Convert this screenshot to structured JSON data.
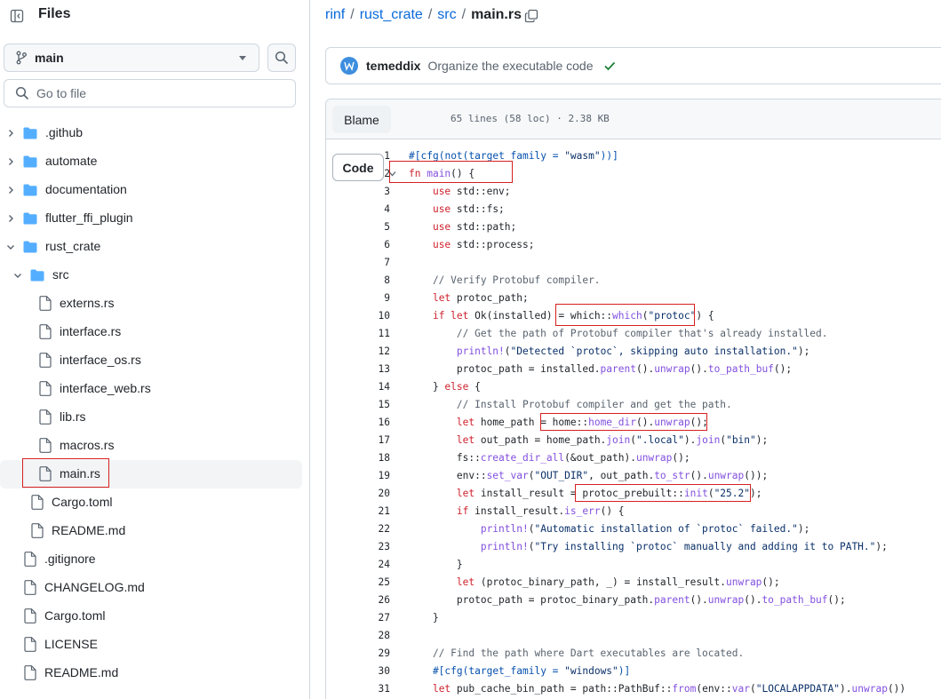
{
  "sidebar": {
    "title": "Files",
    "branch": "main",
    "goto_placeholder": "Go to file",
    "tree": [
      {
        "label": ".github",
        "kind": "folder",
        "depth": 0,
        "expanded": false
      },
      {
        "label": "automate",
        "kind": "folder",
        "depth": 0,
        "expanded": false
      },
      {
        "label": "documentation",
        "kind": "folder",
        "depth": 0,
        "expanded": false
      },
      {
        "label": "flutter_ffi_plugin",
        "kind": "folder",
        "depth": 0,
        "expanded": false
      },
      {
        "label": "rust_crate",
        "kind": "folder",
        "depth": 0,
        "expanded": true
      },
      {
        "label": "src",
        "kind": "folder",
        "depth": 1,
        "expanded": true
      },
      {
        "label": "externs.rs",
        "kind": "file",
        "depth": 2
      },
      {
        "label": "interface.rs",
        "kind": "file",
        "depth": 2
      },
      {
        "label": "interface_os.rs",
        "kind": "file",
        "depth": 2
      },
      {
        "label": "interface_web.rs",
        "kind": "file",
        "depth": 2
      },
      {
        "label": "lib.rs",
        "kind": "file",
        "depth": 2
      },
      {
        "label": "macros.rs",
        "kind": "file",
        "depth": 2
      },
      {
        "label": "main.rs",
        "kind": "file",
        "depth": 2,
        "selected": true
      },
      {
        "label": "Cargo.toml",
        "kind": "file",
        "depth": 1
      },
      {
        "label": "README.md",
        "kind": "file",
        "depth": 1
      },
      {
        "label": ".gitignore",
        "kind": "file",
        "depth": 0
      },
      {
        "label": "CHANGELOG.md",
        "kind": "file",
        "depth": 0
      },
      {
        "label": "Cargo.toml",
        "kind": "file",
        "depth": 0
      },
      {
        "label": "LICENSE",
        "kind": "file",
        "depth": 0
      },
      {
        "label": "README.md",
        "kind": "file",
        "depth": 0
      }
    ]
  },
  "breadcrumb": {
    "repo": "rinf",
    "crate": "rust_crate",
    "dir": "src",
    "sep": "/",
    "file": "main.rs"
  },
  "commit": {
    "author": "temeddix",
    "message": "Organize the executable code"
  },
  "file_view": {
    "tab_code": "Code",
    "tab_blame": "Blame",
    "meta": "65 lines (58 loc) · 2.38 KB"
  },
  "code_lines": [
    [
      {
        "t": "#[",
        "c": "mc"
      },
      {
        "t": "cfg",
        "c": "mc"
      },
      {
        "t": "(",
        "c": "mc"
      },
      {
        "t": "not",
        "c": "mc"
      },
      {
        "t": "(target_family = ",
        "c": "mc"
      },
      {
        "t": "\"wasm\"",
        "c": "str"
      },
      {
        "t": "))]",
        "c": "mc"
      }
    ],
    [
      {
        "t": "fn ",
        "c": "kw"
      },
      {
        "t": "main",
        "c": "fn"
      },
      {
        "t": "() {",
        "c": ""
      }
    ],
    [
      {
        "t": "    ",
        "c": ""
      },
      {
        "t": "use ",
        "c": "kw"
      },
      {
        "t": "std::env;",
        "c": ""
      }
    ],
    [
      {
        "t": "    ",
        "c": ""
      },
      {
        "t": "use ",
        "c": "kw"
      },
      {
        "t": "std::fs;",
        "c": ""
      }
    ],
    [
      {
        "t": "    ",
        "c": ""
      },
      {
        "t": "use ",
        "c": "kw"
      },
      {
        "t": "std::path;",
        "c": ""
      }
    ],
    [
      {
        "t": "    ",
        "c": ""
      },
      {
        "t": "use ",
        "c": "kw"
      },
      {
        "t": "std::process;",
        "c": ""
      }
    ],
    [],
    [
      {
        "t": "    // Verify Protobuf compiler.",
        "c": "cm"
      }
    ],
    [
      {
        "t": "    ",
        "c": ""
      },
      {
        "t": "let ",
        "c": "kw"
      },
      {
        "t": "protoc_path;",
        "c": ""
      }
    ],
    [
      {
        "t": "    ",
        "c": ""
      },
      {
        "t": "if let ",
        "c": "kw"
      },
      {
        "t": "Ok(installed) = which::",
        "c": ""
      },
      {
        "t": "which",
        "c": "fn"
      },
      {
        "t": "(",
        "c": ""
      },
      {
        "t": "\"protoc\"",
        "c": "str"
      },
      {
        "t": ") {",
        "c": ""
      }
    ],
    [
      {
        "t": "        // Get the path of Protobuf compiler that's already installed.",
        "c": "cm"
      }
    ],
    [
      {
        "t": "        ",
        "c": ""
      },
      {
        "t": "println!",
        "c": "fn"
      },
      {
        "t": "(",
        "c": ""
      },
      {
        "t": "\"Detected `protoc`, skipping auto installation.\"",
        "c": "str"
      },
      {
        "t": ");",
        "c": ""
      }
    ],
    [
      {
        "t": "        protoc_path = installed.",
        "c": ""
      },
      {
        "t": "parent",
        "c": "fn"
      },
      {
        "t": "().",
        "c": ""
      },
      {
        "t": "unwrap",
        "c": "fn"
      },
      {
        "t": "().",
        "c": ""
      },
      {
        "t": "to_path_buf",
        "c": "fn"
      },
      {
        "t": "();",
        "c": ""
      }
    ],
    [
      {
        "t": "    } ",
        "c": ""
      },
      {
        "t": "else",
        "c": "kw"
      },
      {
        "t": " {",
        "c": ""
      }
    ],
    [
      {
        "t": "        // Install Protobuf compiler and get the path.",
        "c": "cm"
      }
    ],
    [
      {
        "t": "        ",
        "c": ""
      },
      {
        "t": "let ",
        "c": "kw"
      },
      {
        "t": "home_path = home::",
        "c": ""
      },
      {
        "t": "home_dir",
        "c": "fn"
      },
      {
        "t": "().",
        "c": ""
      },
      {
        "t": "unwrap",
        "c": "fn"
      },
      {
        "t": "();",
        "c": ""
      }
    ],
    [
      {
        "t": "        ",
        "c": ""
      },
      {
        "t": "let ",
        "c": "kw"
      },
      {
        "t": "out_path = home_path.",
        "c": ""
      },
      {
        "t": "join",
        "c": "fn"
      },
      {
        "t": "(",
        "c": ""
      },
      {
        "t": "\".local\"",
        "c": "str"
      },
      {
        "t": ").",
        "c": ""
      },
      {
        "t": "join",
        "c": "fn"
      },
      {
        "t": "(",
        "c": ""
      },
      {
        "t": "\"bin\"",
        "c": "str"
      },
      {
        "t": ");",
        "c": ""
      }
    ],
    [
      {
        "t": "        fs::",
        "c": ""
      },
      {
        "t": "create_dir_all",
        "c": "fn"
      },
      {
        "t": "(&out_path).",
        "c": ""
      },
      {
        "t": "unwrap",
        "c": "fn"
      },
      {
        "t": "();",
        "c": ""
      }
    ],
    [
      {
        "t": "        env::",
        "c": ""
      },
      {
        "t": "set_var",
        "c": "fn"
      },
      {
        "t": "(",
        "c": ""
      },
      {
        "t": "\"OUT_DIR\"",
        "c": "str"
      },
      {
        "t": ", out_path.",
        "c": ""
      },
      {
        "t": "to_str",
        "c": "fn"
      },
      {
        "t": "().",
        "c": ""
      },
      {
        "t": "unwrap",
        "c": "fn"
      },
      {
        "t": "());",
        "c": ""
      }
    ],
    [
      {
        "t": "        ",
        "c": ""
      },
      {
        "t": "let ",
        "c": "kw"
      },
      {
        "t": "install_result = protoc_prebuilt::",
        "c": ""
      },
      {
        "t": "init",
        "c": "fn"
      },
      {
        "t": "(",
        "c": ""
      },
      {
        "t": "\"25.2\"",
        "c": "str"
      },
      {
        "t": ");",
        "c": ""
      }
    ],
    [
      {
        "t": "        ",
        "c": ""
      },
      {
        "t": "if ",
        "c": "kw"
      },
      {
        "t": "install_result.",
        "c": ""
      },
      {
        "t": "is_err",
        "c": "fn"
      },
      {
        "t": "() {",
        "c": ""
      }
    ],
    [
      {
        "t": "            ",
        "c": ""
      },
      {
        "t": "println!",
        "c": "fn"
      },
      {
        "t": "(",
        "c": ""
      },
      {
        "t": "\"Automatic installation of `protoc` failed.\"",
        "c": "str"
      },
      {
        "t": ");",
        "c": ""
      }
    ],
    [
      {
        "t": "            ",
        "c": ""
      },
      {
        "t": "println!",
        "c": "fn"
      },
      {
        "t": "(",
        "c": ""
      },
      {
        "t": "\"Try installing `protoc` manually and adding it to PATH.\"",
        "c": "str"
      },
      {
        "t": ");",
        "c": ""
      }
    ],
    [
      {
        "t": "        }",
        "c": ""
      }
    ],
    [
      {
        "t": "        ",
        "c": ""
      },
      {
        "t": "let ",
        "c": "kw"
      },
      {
        "t": "(protoc_binary_path, _) = install_result.",
        "c": ""
      },
      {
        "t": "unwrap",
        "c": "fn"
      },
      {
        "t": "();",
        "c": ""
      }
    ],
    [
      {
        "t": "        protoc_path = protoc_binary_path.",
        "c": ""
      },
      {
        "t": "parent",
        "c": "fn"
      },
      {
        "t": "().",
        "c": ""
      },
      {
        "t": "unwrap",
        "c": "fn"
      },
      {
        "t": "().",
        "c": ""
      },
      {
        "t": "to_path_buf",
        "c": "fn"
      },
      {
        "t": "();",
        "c": ""
      }
    ],
    [
      {
        "t": "    }",
        "c": ""
      }
    ],
    [],
    [
      {
        "t": "    // Find the path where Dart executables are located.",
        "c": "cm"
      }
    ],
    [
      {
        "t": "    #[",
        "c": "mc"
      },
      {
        "t": "cfg",
        "c": "mc"
      },
      {
        "t": "(target_family = ",
        "c": "mc"
      },
      {
        "t": "\"windows\"",
        "c": "str"
      },
      {
        "t": ")]",
        "c": "mc"
      }
    ],
    [
      {
        "t": "    ",
        "c": ""
      },
      {
        "t": "let ",
        "c": "kw"
      },
      {
        "t": "pub_cache_bin_path = path::PathBuf::",
        "c": ""
      },
      {
        "t": "from",
        "c": "fn"
      },
      {
        "t": "(env::",
        "c": ""
      },
      {
        "t": "var",
        "c": "fn"
      },
      {
        "t": "(",
        "c": ""
      },
      {
        "t": "\"LOCALAPPDATA\"",
        "c": "str"
      },
      {
        "t": ").",
        "c": ""
      },
      {
        "t": "unwrap",
        "c": "fn"
      },
      {
        "t": "())",
        "c": ""
      }
    ]
  ],
  "colors": {
    "link": "#0969da",
    "highlight_box": "#d62020",
    "folder": "#54aeff",
    "check": "#1a7f37"
  },
  "icons": {
    "collapse": "sidebar-collapse-icon",
    "branch": "git-branch-icon",
    "search": "search-icon",
    "folder": "folder-icon",
    "file": "file-icon",
    "chevron": "chevron-icon",
    "copy": "copy-icon",
    "check": "check-icon"
  }
}
